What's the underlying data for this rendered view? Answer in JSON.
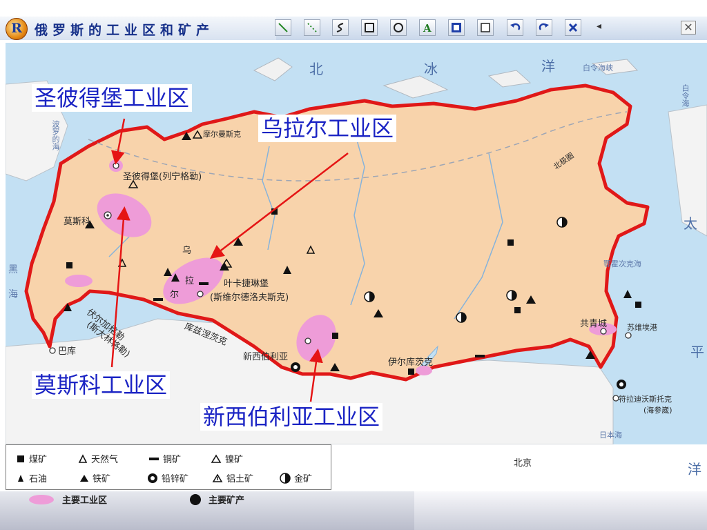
{
  "app": {
    "logo": "R",
    "title": "俄罗斯的工业区和矿产"
  },
  "toolbar": {
    "tools": [
      "line-tool-icon",
      "dotted-line-tool-icon",
      "curve-tool-icon",
      "rectangle-tool-icon",
      "ellipse-tool-icon",
      "text-tool-icon",
      "fill-color-tool-icon",
      "clear-tool-icon",
      "undo-icon",
      "redo-icon",
      "delete-icon"
    ],
    "scroll_left": "◂",
    "close": "✕"
  },
  "map": {
    "oceans": {
      "north": "北",
      "ice": "冰",
      "ocean": "洋",
      "pacific_tai": "太",
      "pacific_ping": "平",
      "pacific_yang": "洋"
    },
    "seas": {
      "east_siberian": "白令海峡",
      "bering": "白令海",
      "okhotsk": "鄂霍次克海",
      "japan": "日本海",
      "black_sea_1": "黑",
      "black_sea_2": "海",
      "baltic": "波罗的海",
      "caspian_line1": "伏尔加格勒",
      "caspian_line2": "(斯大林格勒)"
    },
    "places": {
      "murmansk": "摩尔曼斯克",
      "st_petersburg": "圣彼得堡(列宁格勒)",
      "moscow": "莫斯科",
      "ural_1": "乌",
      "ural_2": "拉",
      "ural_3": "尔",
      "yekaterinburg_1": "叶卡捷琳堡",
      "yekaterinburg_2": "(斯维尔德洛夫斯克)",
      "kuzbass": "库兹涅茨克",
      "novosibirsk": "新西伯利亚",
      "irkutsk": "伊尔库茨克",
      "komsomolsk": "共青城",
      "sovetskaya_gavan": "苏维埃港",
      "vladivostok_1": "符拉迪沃斯托克",
      "vladivostok_2": "(海参崴)",
      "baku": "巴库",
      "beijing": "北京",
      "arctic_circle": "北极圈"
    }
  },
  "annotations": {
    "st_petersburg": "圣彼得堡工业区",
    "ural": "乌拉尔工业区",
    "moscow": "莫斯科工业区",
    "novosibirsk": "新西伯利亚工业区"
  },
  "legend": {
    "coal": "煤矿",
    "natural_gas": "天然气",
    "copper": "铜矿",
    "nickel": "镍矿",
    "oil": "石油",
    "iron": "铁矿",
    "lead_zinc": "铅锌矿",
    "bauxite": "铝土矿",
    "gold": "金矿",
    "industrial_area": "主要工业区",
    "main_minerals": "主要矿产"
  },
  "colors": {
    "land": "#f8d3ab",
    "water": "#c3e0f3",
    "border": "#e01818",
    "industrial": "#ee9cd8",
    "annotation_text": "#1b24c4",
    "arrow": "#e51515"
  }
}
